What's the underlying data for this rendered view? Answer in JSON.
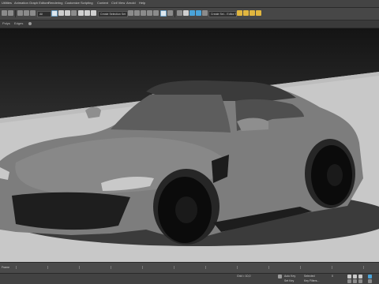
{
  "menu": [
    "Utilities",
    "Animation",
    "Graph Editors",
    "Rendering",
    "Customize",
    "Scripting",
    "Content",
    "Civil View",
    "Arnold",
    "Help"
  ],
  "toolbar": {
    "selection_filter": "All",
    "view_dropdown": "Create Selection Set",
    "named_set": "Create Sel... Editor Set"
  },
  "viewport_labels": [
    "Polys",
    "Edges"
  ],
  "timeline": {
    "frame_label": "Frame"
  },
  "statusbar": {
    "grid_label": "Grid = 10,0",
    "key_label": "Set Key",
    "auto_key_label": "Auto Key",
    "selected_label": "Selected",
    "key_filters_label": "Key Filters...",
    "time_value": "0"
  },
  "colors": {
    "menubar_bg": "#444444",
    "toolbar_bg": "#474747",
    "accent_blue": "#4aa3d8",
    "icon_yellow": "#e1b63f",
    "car_body": "#7d7d7d",
    "floor": "#c8c8c8"
  }
}
